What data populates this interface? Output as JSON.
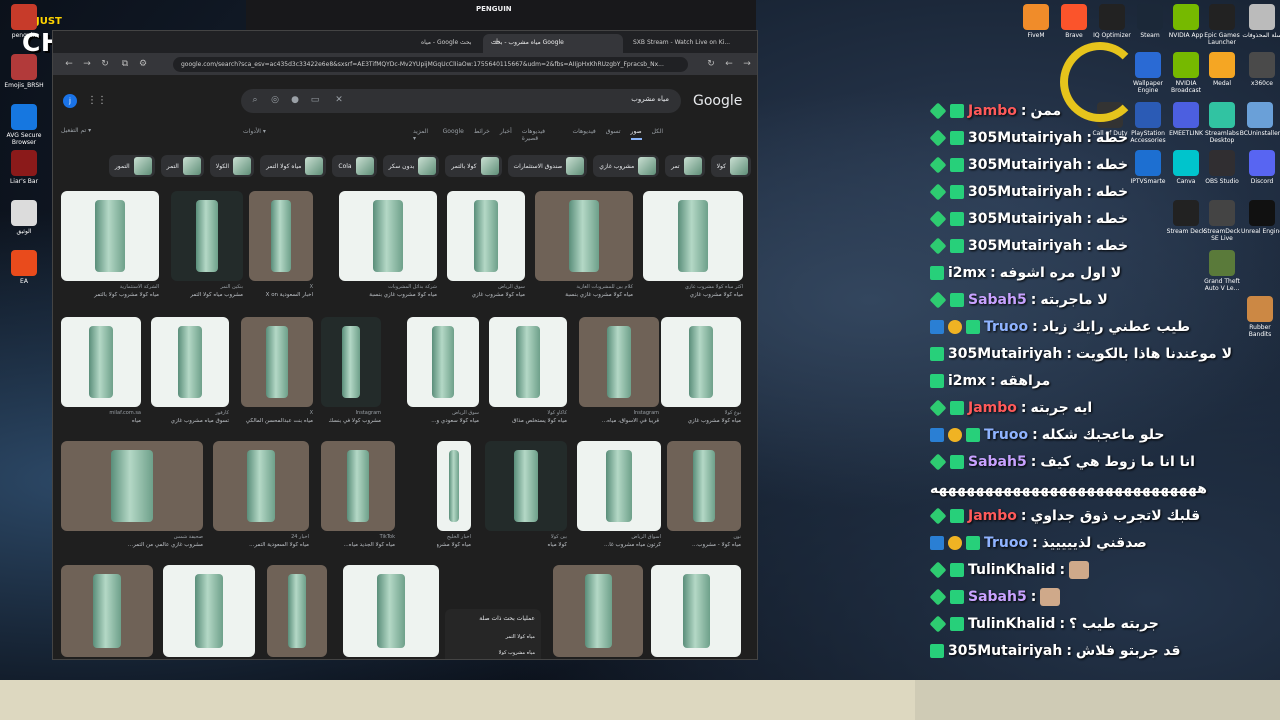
{
  "overlay": {
    "logo_top": "JUST",
    "logo_main": "CHATTING",
    "username_left": "penguin"
  },
  "desktop_left_icons": [
    {
      "label": "penguin",
      "color": "#c73b2a"
    },
    {
      "label": "Emojis_BRSH",
      "color": "#b23a3a"
    },
    {
      "label": "AVG Secure Browser",
      "color": "#1677e0"
    },
    {
      "label": "Liar's Bar",
      "color": "#8b1a1a"
    },
    {
      "label": "الوثيق",
      "color": "#dcdcdc"
    },
    {
      "label": "EA",
      "color": "#e94b1c"
    }
  ],
  "desktop_right_icons": [
    {
      "label": "FiveM",
      "color": "#f08c2a"
    },
    {
      "label": "Brave",
      "color": "#fb542b"
    },
    {
      "label": "IQ Optimizer",
      "color": "#222"
    },
    {
      "label": "Steam",
      "color": "#1b2838"
    },
    {
      "label": "NVIDIA App",
      "color": "#76b900"
    },
    {
      "label": "Epic Games Launcher",
      "color": "#222"
    },
    {
      "label": "سلة المحذوفات",
      "color": "#bbb"
    },
    {
      "label": "Call of Duty",
      "color": "#333"
    },
    {
      "label": "PlayStation Accessories",
      "color": "#2b5bb5"
    },
    {
      "label": "EMEETLINK",
      "color": "#4c5fe0"
    },
    {
      "label": "Streamlabs Desktop",
      "color": "#31c3a2"
    },
    {
      "label": "BCUninstaller",
      "color": "#6aa0d8"
    },
    {
      "label": "IPTVSmarte",
      "color": "#1d6fd1"
    },
    {
      "label": "Canva",
      "color": "#00c4cc"
    },
    {
      "label": "OBS Studio",
      "color": "#302e31"
    },
    {
      "label": "Discord",
      "color": "#5865f2"
    },
    {
      "label": "Stream Deck",
      "color": "#222"
    },
    {
      "label": "StreamDeck SE Live",
      "color": "#444"
    },
    {
      "label": "Unreal Engine",
      "color": "#111"
    },
    {
      "label": "Grand Theft Auto V Le...",
      "color": "#5a7a3a"
    },
    {
      "label": "Rubber Bandits",
      "color": "#c84"
    },
    {
      "label": "Wallpaper Engine",
      "color": "#2a6ad4"
    },
    {
      "label": "NVIDIA Broadcast",
      "color": "#76b900"
    },
    {
      "label": "Medal",
      "color": "#f5a623"
    },
    {
      "label": "x360ce",
      "color": "#4a4a4a"
    }
  ],
  "twitch_header": {
    "channel": "PENGUIN",
    "channel_small": "PENGUIN",
    "chat_label": "L chat - ..."
  },
  "browser": {
    "tabs": [
      {
        "label": "مياه - Google بحث",
        "active": false
      },
      {
        "label": "مياه مشروب - بحث Google",
        "active": true
      },
      {
        "label": "SXB Stream - Watch Live on Ki...",
        "active": false
      }
    ],
    "url": "google.com/search?sca_esv=ac435d3c33422e6e8&sxsrf=AE3TifMQYDc-Mv2YUpijMGqUcClIiaOw:1755640115667&udm=2&fbs=AIIjpHxKhRUzgbY_Fpracsb_Nx...",
    "search_query": "مياه مشروب",
    "google_logo": "Google",
    "account_initial": "j",
    "search_tabs": [
      {
        "label": "الكل",
        "active": false
      },
      {
        "label": "صور",
        "active": true
      },
      {
        "label": "تسوق",
        "active": false
      },
      {
        "label": "فيديوهات",
        "active": false
      },
      {
        "label": "فيديوهات قصيرة",
        "active": false
      },
      {
        "label": "أخبار",
        "active": false
      },
      {
        "label": "خرائط",
        "active": false
      },
      {
        "label": "Google",
        "active": false
      },
      {
        "label": "المزيد ▾",
        "active": false
      }
    ],
    "tools_label": "الأدوات ▾",
    "safe_search": "تم التفعيل ▾",
    "chips": [
      "كولا",
      "تمر",
      "مشروب غازي",
      "صندوق الاستثمارات",
      "كولا بالتمر",
      "بدون سكر",
      "Cola",
      "مياه كولا التمر",
      "الكولا",
      "التمر",
      "التمور"
    ],
    "results_row1": [
      {
        "caption": "مياه كولا مشروب غازي",
        "source": "أكثر مياه كولا مشروب غازي"
      },
      {
        "caption": "مياه كولا مشروب غازي بنسبة",
        "source": "كلام بين للمشروبات الغازية"
      },
      {
        "caption": "مياه كولا مشروب غازي",
        "source": "سوق الرياض"
      },
      {
        "caption": "مياه كولا مشروب غازي بنسبة",
        "source": "شركة بدائل المشروبات"
      },
      {
        "caption": "أخبار السعودية X on",
        "source": "X"
      },
      {
        "caption": "مشروب مياه كولا التمر",
        "source": "بنكين التمر"
      },
      {
        "caption": "مياه كولا مشروب كولا بالتمر",
        "source": "الشركة الاستثمارية"
      }
    ],
    "results_row2": [
      {
        "caption": "مياه كولا مشروب غازي",
        "source": "نوع كولا"
      },
      {
        "caption": "قريباً في الأسواق، مياه...",
        "source": "Instagram"
      },
      {
        "caption": "مياه كولا يستخلص مذاق",
        "source": "كاكاو كولا"
      },
      {
        "caption": "مياه كولا سعودي و...",
        "source": "سوق الرياض"
      },
      {
        "caption": "مشروب كولا في بنسك",
        "source": "Instagram"
      },
      {
        "caption": "مياه بنت عبدالمحسن المالكي",
        "source": "X"
      },
      {
        "caption": "تسوق مياه مشروب غازي",
        "source": "كارفور"
      },
      {
        "caption": "مياه",
        "source": "milaf.com.sa"
      }
    ],
    "results_row3": [
      {
        "caption": "مياه كولا - مشروب...",
        "source": "نون"
      },
      {
        "caption": "كرتون مياه مشروب غا...",
        "source": "أسواق الرياض"
      },
      {
        "caption": "كولا مياه",
        "source": "بين كولا"
      },
      {
        "caption": "مياه كولا مشروب غا...",
        "source": "أخبار الخليج"
      },
      {
        "caption": "مياه كولا الجديد مياه...",
        "source": "TikTok"
      },
      {
        "caption": "مياه كولا السعودية التمر...",
        "source": "أخبار 24"
      },
      {
        "caption": "مشروب غازي عالمي من التمر...",
        "source": "صحيفة شمس"
      }
    ],
    "related": {
      "title": "عمليات بحث ذات صلة",
      "items": [
        "مياه كولا التمر",
        "مياه مشروب كولا"
      ]
    }
  },
  "chat": [
    {
      "name": "Jambo",
      "text": "ممن",
      "name_color": "#ff5a5a",
      "badges": [
        "diamond",
        "gg"
      ]
    },
    {
      "name": "305Mutairiyah",
      "text": "خطه",
      "name_color": "#ffffff",
      "badges": [
        "diamond",
        "gg"
      ]
    },
    {
      "name": "305Mutairiyah",
      "text": "خطه",
      "name_color": "#ffffff",
      "badges": [
        "diamond",
        "gg"
      ]
    },
    {
      "name": "305Mutairiyah",
      "text": "خطه",
      "name_color": "#ffffff",
      "badges": [
        "diamond",
        "gg"
      ]
    },
    {
      "name": "305Mutairiyah",
      "text": "خطه",
      "name_color": "#ffffff",
      "badges": [
        "diamond",
        "gg"
      ]
    },
    {
      "name": "305Mutairiyah",
      "text": "خطه",
      "name_color": "#ffffff",
      "badges": [
        "diamond",
        "gg"
      ]
    },
    {
      "name": "i2mx",
      "text": "لا اول مره اشوفه",
      "name_color": "#ffffff",
      "badges": [
        "gg"
      ]
    },
    {
      "name": "Sabah5",
      "text": "لا ماجربته",
      "name_color": "#c8a2ff",
      "badges": [
        "diamond",
        "gg"
      ]
    },
    {
      "name": "Truoo",
      "text": "طيب عطني رايك زياد",
      "name_color": "#8fb3ff",
      "badges": [
        "prime",
        "coin",
        "gg"
      ]
    },
    {
      "name": "305Mutairiyah",
      "text": "لا موعندنا هاذا بالكويت",
      "name_color": "#ffffff",
      "badges": [
        "gg"
      ]
    },
    {
      "name": "i2mx",
      "text": "مراهقه",
      "name_color": "#ffffff",
      "badges": [
        "gg"
      ]
    },
    {
      "name": "Jambo",
      "text": "ايه جربته",
      "name_color": "#ff5a5a",
      "badges": [
        "diamond",
        "gg"
      ]
    },
    {
      "name": "Truoo",
      "text": "حلو ماعجبك شكله",
      "name_color": "#8fb3ff",
      "badges": [
        "prime",
        "coin",
        "gg"
      ]
    },
    {
      "name": "Sabah5",
      "text": "انا انا ما زوط هي كيف",
      "name_color": "#c8a2ff",
      "badges": [
        "diamond",
        "gg"
      ]
    },
    {
      "name": "",
      "text": "هههههههههههههههههههههههههههههه",
      "name_color": "#ffffff",
      "badges": []
    },
    {
      "name": "Jambo",
      "text": "قلبك لاتجرب ذوق جداوي",
      "name_color": "#ff5a5a",
      "badges": [
        "diamond",
        "gg"
      ]
    },
    {
      "name": "Truoo",
      "text": "صدقني لذيييييذ",
      "name_color": "#8fb3ff",
      "badges": [
        "prime",
        "coin",
        "gg"
      ]
    },
    {
      "name": "TulinKhalid",
      "text": "",
      "name_color": "#ffffff",
      "badges": [
        "diamond",
        "gg"
      ],
      "emote": true
    },
    {
      "name": "Sabah5",
      "text": "",
      "name_color": "#c8a2ff",
      "badges": [
        "diamond",
        "gg"
      ],
      "emote": true
    },
    {
      "name": "TulinKhalid",
      "text": "جربته طيب ؟",
      "name_color": "#ffffff",
      "badges": [
        "diamond",
        "gg"
      ]
    },
    {
      "name": "305Mutairiyah",
      "text": "قد جربتو فلاش",
      "name_color": "#ffffff",
      "badges": [
        "gg"
      ]
    }
  ]
}
